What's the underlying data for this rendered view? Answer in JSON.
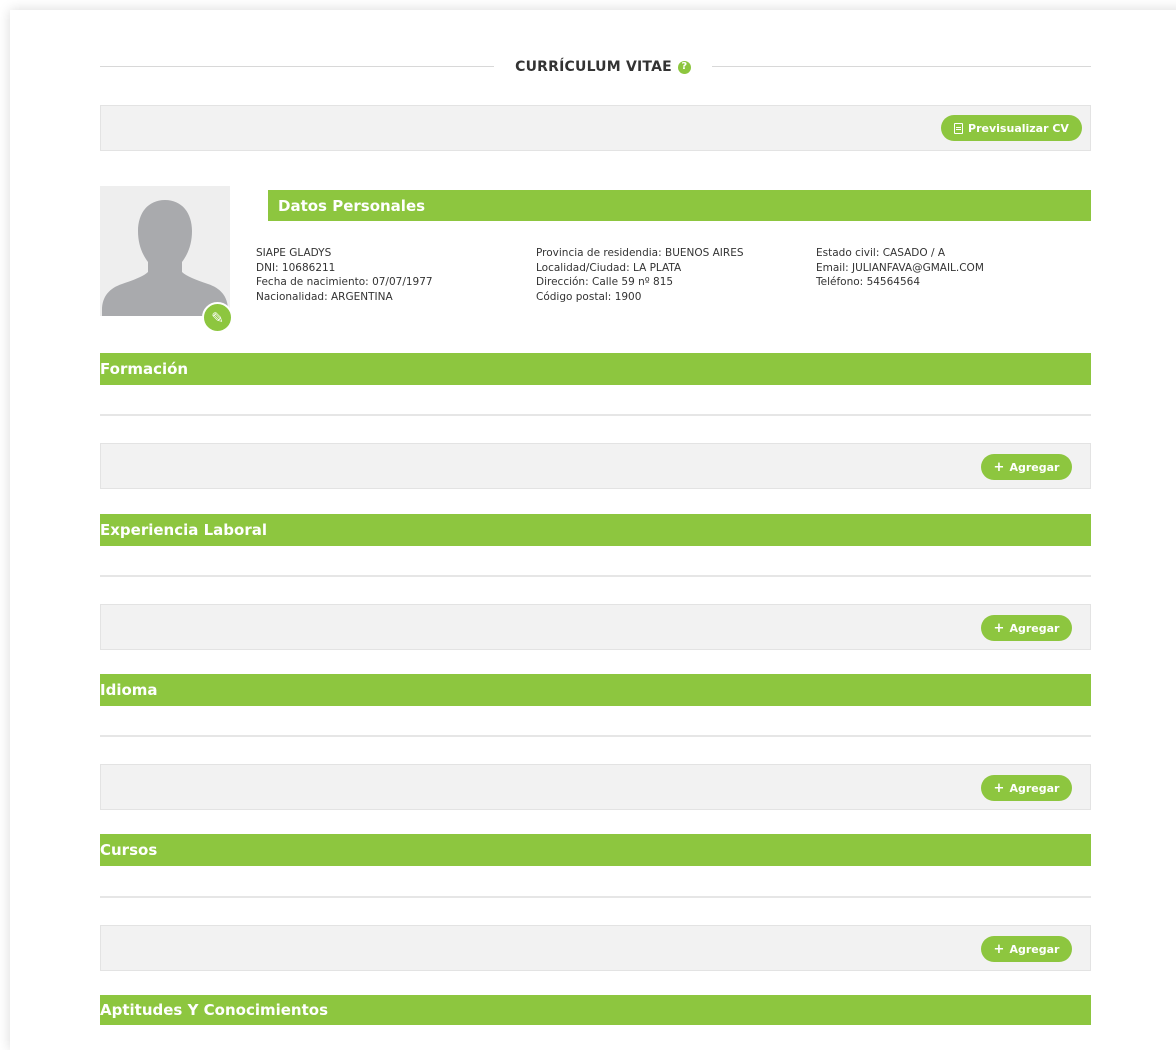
{
  "page": {
    "title": "CURRÍCULUM VITAE",
    "help_icon": "question-circle-icon",
    "accent_color": "#8dc63f"
  },
  "toolbar": {
    "preview_label": "Previsualizar CV",
    "preview_icon": "document-icon"
  },
  "personal": {
    "header": "Datos Personales",
    "name": "SIAPE GLADYS",
    "dni_label": "DNI:",
    "dni": "10686211",
    "birth_label": "Fecha de nacimiento:",
    "birth": "07/07/1977",
    "nationality_label": "Nacionalidad:",
    "nationality": "ARGENTINA",
    "province_label": "Provincia de residendia:",
    "province": "BUENOS AIRES",
    "city_label": "Localidad/Ciudad:",
    "city": "LA PLATA",
    "address_label": "Dirección:",
    "address": "Calle 59 nº 815",
    "postal_label": "Código postal:",
    "postal": "1900",
    "civil_label": "Estado civil:",
    "civil": "CASADO / A",
    "email_label": "Email:",
    "email": "JULIANFAVA@GMAIL.COM",
    "phone_label": "Teléfono:",
    "phone": "54564564",
    "edit_icon": "pencil-icon"
  },
  "sections": [
    {
      "title": "Formación",
      "add_label": "Agregar"
    },
    {
      "title": "Experiencia Laboral",
      "add_label": "Agregar"
    },
    {
      "title": "Idioma",
      "add_label": "Agregar"
    },
    {
      "title": "Cursos",
      "add_label": "Agregar"
    },
    {
      "title": "Aptitudes Y Conocimientos"
    }
  ]
}
